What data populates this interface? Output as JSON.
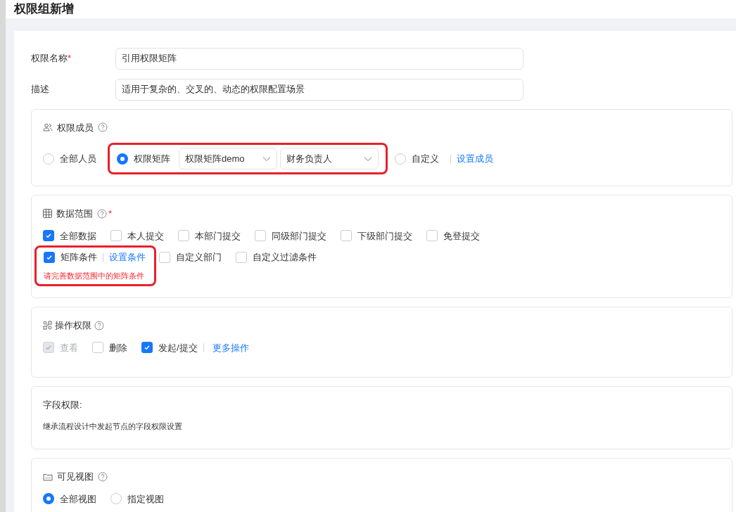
{
  "title": "权限组新增",
  "fields": [
    {
      "label": "权限名称",
      "required_mark": "*",
      "value": "引用权限矩阵"
    },
    {
      "label": "描述",
      "value": "适用于复杂的、交叉的、动态的权限配置场景"
    }
  ],
  "members": {
    "title": "权限成员",
    "options": [
      {
        "kind": "plain",
        "label": "全部人员",
        "selected": false
      },
      {
        "kind": "matrix",
        "label": "权限矩阵",
        "selected": true,
        "selects": [
          "权限矩阵demo",
          "财务负责人"
        ]
      },
      {
        "kind": "custom",
        "label": "自定义",
        "selected": false,
        "link": "设置成员"
      }
    ]
  },
  "data_scope": {
    "title": "数据范围",
    "required_mark": "*",
    "row_1": [
      {
        "label": "全部数据",
        "checked": true
      },
      {
        "label": "本人提交",
        "checked": false
      },
      {
        "label": "本部门提交",
        "checked": false
      },
      {
        "label": "同级部门提交",
        "checked": false
      },
      {
        "label": "下级部门提交",
        "checked": false
      },
      {
        "label": "免登提交",
        "checked": false
      }
    ],
    "matrix": {
      "label": "矩阵条件",
      "checked": true,
      "link": "设置条件",
      "error": "请完善数据范围中的矩阵条件"
    },
    "row_2": [
      {
        "label": "自定义部门",
        "checked": false
      },
      {
        "label": "自定义过滤条件",
        "checked": false
      }
    ]
  },
  "operations": {
    "title": "操作权限",
    "items": [
      {
        "label": "查看",
        "checked": true,
        "disabled": true
      },
      {
        "label": "删除",
        "checked": false,
        "disabled": false
      },
      {
        "label": "发起/提交",
        "checked": true,
        "disabled": false
      }
    ],
    "link": "更多操作"
  },
  "field_permissions": {
    "title": "字段权限:",
    "text": "继承流程设计中发起节点的字段权限设置"
  },
  "views": {
    "title": "可见视图",
    "options": [
      {
        "label": "全部视图",
        "selected": true
      },
      {
        "label": "指定视图",
        "selected": false
      }
    ]
  }
}
